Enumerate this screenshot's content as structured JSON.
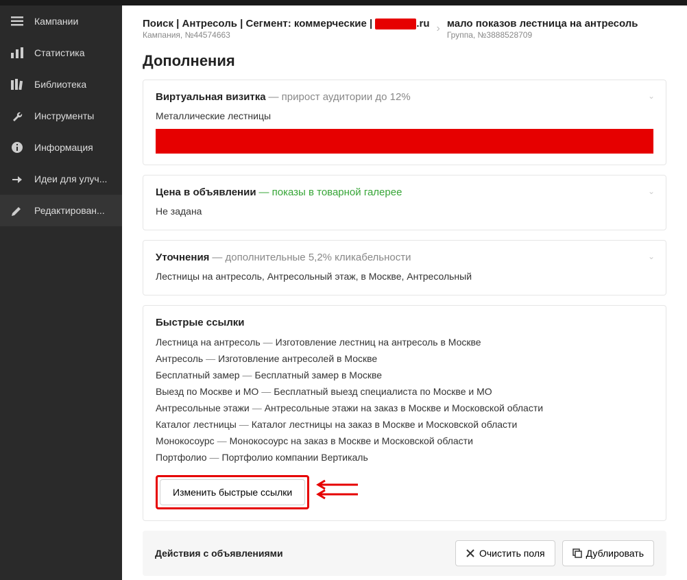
{
  "sidebar": {
    "items": [
      {
        "label": "Кампании",
        "icon": "menu-icon"
      },
      {
        "label": "Статистика",
        "icon": "stats-icon"
      },
      {
        "label": "Библиотека",
        "icon": "library-icon"
      },
      {
        "label": "Инструменты",
        "icon": "tools-icon"
      },
      {
        "label": "Информация",
        "icon": "info-icon"
      },
      {
        "label": "Идеи для улуч...",
        "icon": "ideas-icon"
      },
      {
        "label": "Редактирован...",
        "icon": "edit-icon"
      }
    ]
  },
  "breadcrumb": {
    "seg1_title_prefix": "Поиск | Антресоль | Сегмент: коммерческие | ",
    "seg1_title_suffix": ".ru",
    "seg1_sub": "Кампания, №44574663",
    "seg2_title": "мало показов лестница на антресоль",
    "seg2_sub": "Группа, №3888528709"
  },
  "sectionTitle": "Дополнения",
  "card_vcard": {
    "title": "Виртуальная визитка",
    "subtitle": " — прирост аудитории до 12%",
    "body": "Металлические лестницы"
  },
  "card_price": {
    "title": "Цена в объявлении",
    "subtitle": " — показы в товарной галерее",
    "body": "Не задана"
  },
  "card_callouts": {
    "title": "Уточнения",
    "subtitle": " — дополнительные 5,2% кликабельности",
    "body": "Лестницы на антресоль, Антресольный этаж, в Москве, Антресольный"
  },
  "card_sitelinks": {
    "title": "Быстрые ссылки",
    "links": [
      {
        "name": "Лестница на антресоль",
        "desc": "Изготовление лестниц на антресоль в Москве"
      },
      {
        "name": "Антресоль",
        "desc": "Изготовление антресолей в Москве"
      },
      {
        "name": "Бесплатный замер",
        "desc": "Бесплатный замер в Москве"
      },
      {
        "name": "Выезд по Москве и МО",
        "desc": "Бесплатный выезд специалиста по Москве и МО"
      },
      {
        "name": "Антресольные этажи",
        "desc": "Антресольные этажи на заказ в Москве и Московской области"
      },
      {
        "name": "Каталог лестницы",
        "desc": "Каталог лестницы на заказ в Москве и Московской области"
      },
      {
        "name": "Монокосоурс",
        "desc": "Монокосоурс на заказ в Москве и Московской области"
      },
      {
        "name": "Портфолио",
        "desc": "Портфолио компании Вертикаль"
      }
    ],
    "edit_btn": "Изменить быстрые ссылки"
  },
  "actions": {
    "title": "Действия с объявлениями",
    "clear": "Очистить поля",
    "duplicate": "Дублировать"
  }
}
